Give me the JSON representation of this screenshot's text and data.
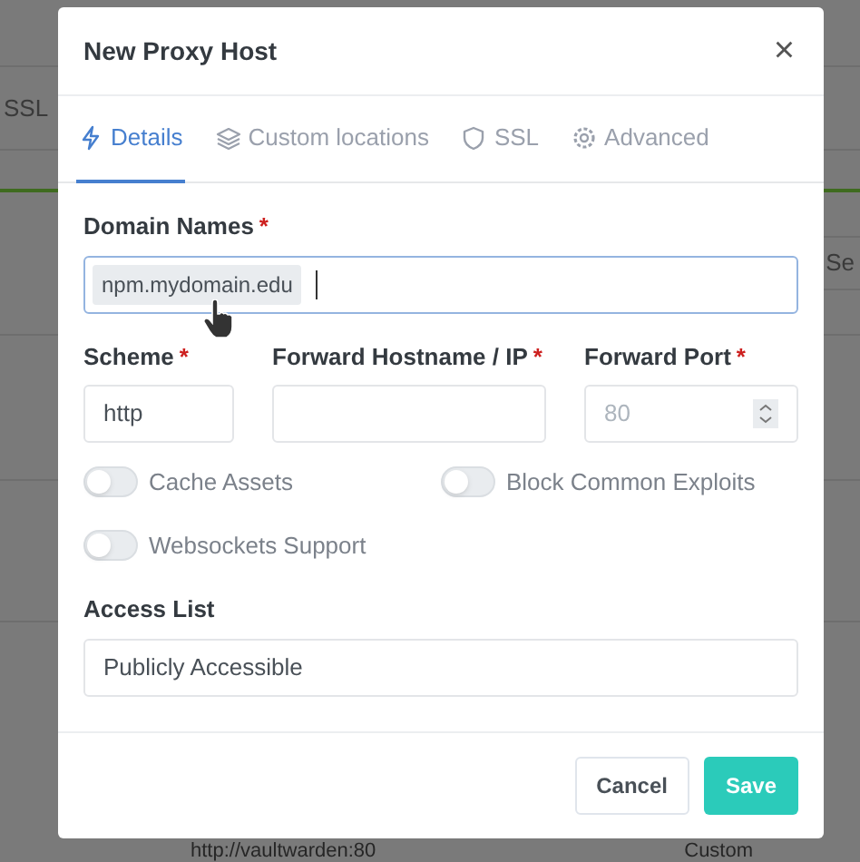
{
  "background": {
    "ssl_tab": "SSL",
    "search_stub": "Se",
    "row_host": "http://vaultwarden:80",
    "row_ssl": "Custom"
  },
  "dialog": {
    "title": "New Proxy Host",
    "close": "×",
    "tabs": [
      {
        "label": "Details",
        "selected": true
      },
      {
        "label": "Custom locations",
        "selected": false
      },
      {
        "label": "SSL",
        "selected": false
      },
      {
        "label": "Advanced",
        "selected": false
      }
    ],
    "domain_names": {
      "label": "Domain Names",
      "required_mark": "*",
      "tags": [
        "npm.mydomain.edu"
      ]
    },
    "scheme": {
      "label": "Scheme",
      "required_mark": "*",
      "value": "http"
    },
    "forward_host": {
      "label": "Forward Hostname / IP",
      "required_mark": "*"
    },
    "forward_port": {
      "label": "Forward Port",
      "required_mark": "*",
      "placeholder": "80"
    },
    "toggles": [
      {
        "label": "Cache Assets",
        "on": false
      },
      {
        "label": "Block Common Exploits",
        "on": false
      },
      {
        "label": "Websockets Support",
        "on": false
      }
    ],
    "access_list": {
      "label": "Access List",
      "value": "Publicly Accessible"
    },
    "buttons": [
      {
        "label": "Cancel",
        "kind": "secondary"
      },
      {
        "label": "Save",
        "kind": "primary"
      }
    ]
  }
}
